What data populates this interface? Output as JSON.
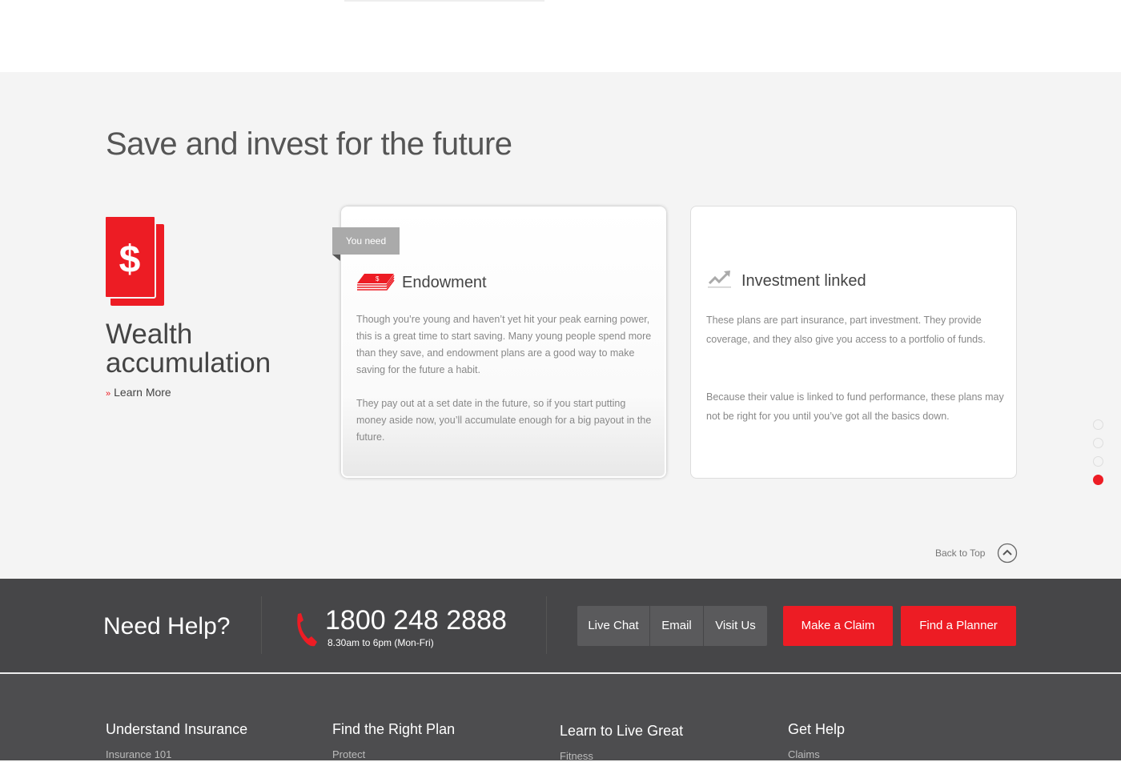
{
  "section_title": "Save and invest for the future",
  "category": {
    "title_line1": "Wealth",
    "title_line2": "accumulation",
    "link_arrow": "»",
    "link": "Learn More",
    "icon": "dollar-book-icon"
  },
  "cards": [
    {
      "tag": "You need",
      "title": "Endowment",
      "icon": "money-stack-icon",
      "paragraphs": [
        "Though you’re young and haven’t yet hit your peak earning power, this is a great time to start saving. Many young people spend more than they save, and endowment plans are a good way to make saving for the future a habit.",
        "They pay out at a set date in the future, so if you start putting money aside now, you’ll accumulate enough for a big payout in the future."
      ]
    },
    {
      "title": "Investment linked",
      "icon": "trend-up-icon",
      "paragraphs": [
        "These plans are part insurance, part investment. They provide coverage, and they also give you access to a portfolio of funds.",
        "Because their value is linked to fund performance, these plans may not be right for you until you’ve got all the basics down."
      ]
    }
  ],
  "pager": {
    "count": 4,
    "active": 4,
    "active_color": "#ed1c24"
  },
  "back_to_top": "Back to Top",
  "help": {
    "title": "Need Help?",
    "phone": "1800 248 2888",
    "hours": "8.30am to 6pm (Mon-Fri)",
    "buttons": [
      "Live Chat",
      "Email",
      "Visit Us"
    ],
    "cta": [
      "Make a Claim",
      "Find a Planner"
    ]
  },
  "footer_cols": [
    {
      "title": "Understand Insurance",
      "link": "Insurance 101"
    },
    {
      "title": "Find the Right Plan",
      "link": "Protect"
    },
    {
      "title": "Learn to Live Great",
      "link": "Fitness"
    },
    {
      "title": "Get Help",
      "link": "Claims"
    }
  ],
  "colors": {
    "brand": "#ed1c24",
    "footer": "#464648"
  }
}
